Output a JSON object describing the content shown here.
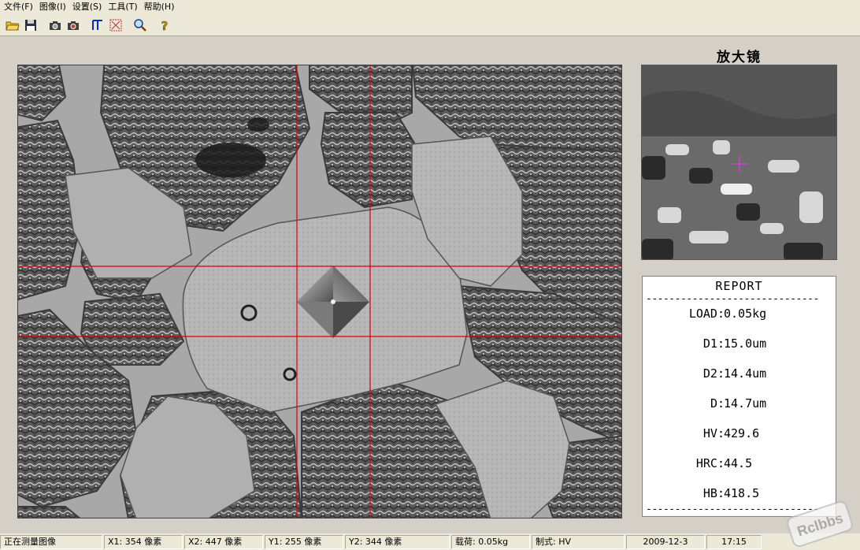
{
  "menu": {
    "items": [
      "文件(F)",
      "图像(I)",
      "设置(S)",
      "工具(T)",
      "帮助(H)"
    ]
  },
  "toolbar": {
    "buttons": [
      "open-folder-icon",
      "save-disk-icon",
      "camera-icon",
      "camera-capture-icon",
      "measure-tool-icon",
      "grid-tool-icon",
      "magnifier-icon",
      "help-icon"
    ]
  },
  "magnifier": {
    "title": "放大镜"
  },
  "report": {
    "title": "REPORT",
    "rule": "------------------------------",
    "rows": [
      {
        "key": "LOAD:",
        "value": "0.05kg"
      },
      {
        "key": "D1:",
        "value": "15.0um"
      },
      {
        "key": "D2:",
        "value": "14.4um"
      },
      {
        "key": "D:",
        "value": "14.7um"
      },
      {
        "key": "HV:",
        "value": "429.6"
      },
      {
        "key": "HRC:",
        "value": "44.5"
      },
      {
        "key": "HB:",
        "value": "418.5"
      }
    ]
  },
  "status": {
    "state": "正在测量图像",
    "x1": "X1: 354 像素",
    "x2": "X2: 447 像素",
    "y1": "Y1: 255 像素",
    "y2": "Y2: 344 像素",
    "load": "载荷: 0.05kg",
    "standard": "制式: HV",
    "date": "2009-12-3",
    "time": "17:15"
  },
  "watermark": {
    "text": "Rclbbs"
  },
  "colors": {
    "crosshair": "#e00000",
    "magnifier_cross": "#d040d0",
    "chrome": "#ece9d8",
    "background": "#d4d0c8"
  }
}
